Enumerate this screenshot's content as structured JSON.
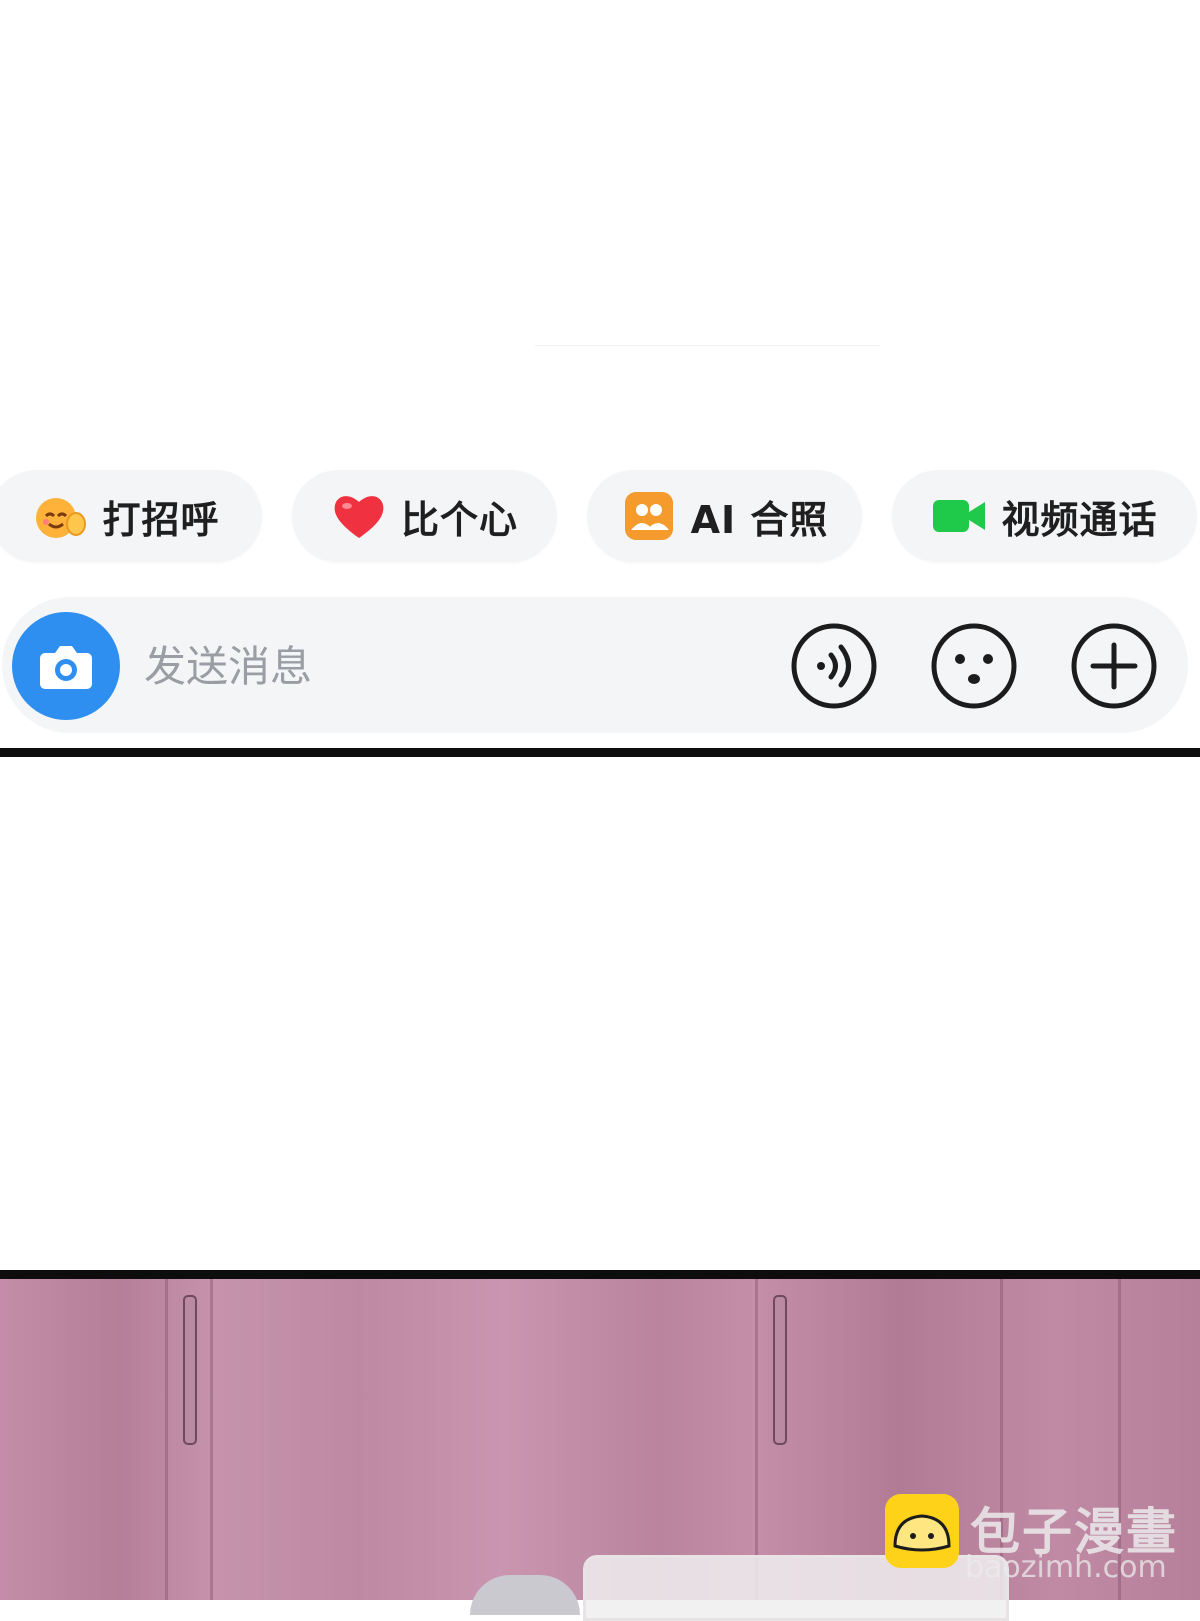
{
  "quick_actions": [
    {
      "label": "打招呼",
      "icon": "wave-emoji-icon"
    },
    {
      "label": "比个心",
      "icon": "heart-icon"
    },
    {
      "label": "AI 合照",
      "icon": "ai-group-photo-icon"
    },
    {
      "label": "视频通话",
      "icon": "video-camera-icon"
    }
  ],
  "composer": {
    "placeholder": "发送消息",
    "camera_icon": "camera-icon",
    "voice_icon": "voice-icon",
    "emoji_icon": "emoji-icon",
    "more_icon": "plus-icon"
  },
  "watermark": {
    "brand": "包子漫畫",
    "domain": "baozimh.com"
  },
  "colors": {
    "accent": "#2e8ff0",
    "heart": "#f0313f",
    "video": "#1fc94a",
    "ai_photo": "#f59a2c",
    "chip_bg": "#f4f5f7",
    "divider": "#0d0d0d"
  }
}
